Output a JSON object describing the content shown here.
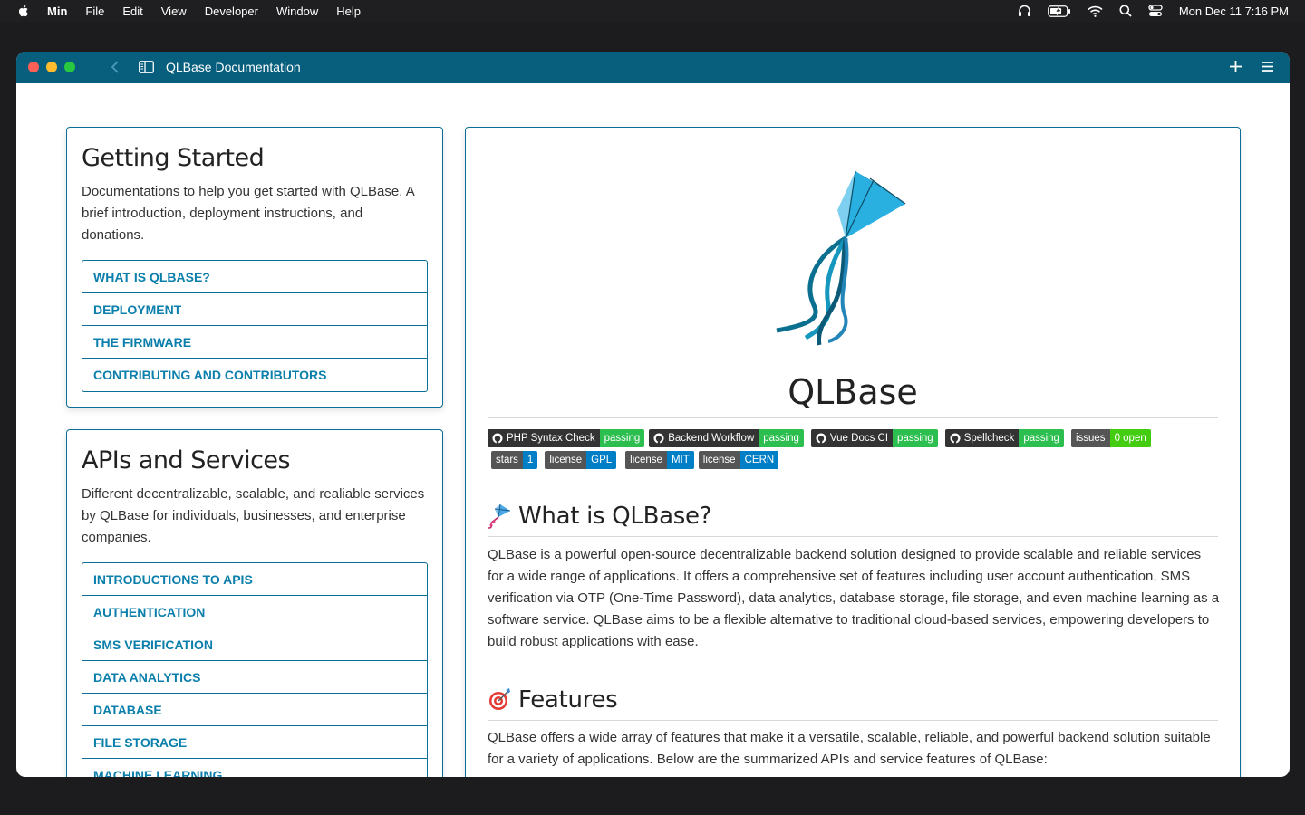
{
  "menubar": {
    "app": "Min",
    "items": [
      "File",
      "Edit",
      "View",
      "Developer",
      "Window",
      "Help"
    ],
    "clock": "Mon Dec 11  7:16 PM"
  },
  "window": {
    "title": "QLBase Documentation"
  },
  "getting_started": {
    "title": "Getting Started",
    "description": "Documentations to help you get started with QLBase. A brief introduction, deployment instructions, and donations.",
    "links": [
      "WHAT IS QLBASE?",
      "DEPLOYMENT",
      "THE FIRMWARE",
      "CONTRIBUTING AND CONTRIBUTORS"
    ]
  },
  "apis": {
    "title": "APIs and Services",
    "description": "Different decentralizable, scalable, and realiable services by QLBase for individuals, businesses, and enterprise companies.",
    "links": [
      "INTRODUCTIONS TO APIS",
      "AUTHENTICATION",
      "SMS VERIFICATION",
      "DATA ANALYTICS",
      "DATABASE",
      "FILE STORAGE",
      "MACHINE LEARNING"
    ]
  },
  "main": {
    "title": "QLBase",
    "badges_row1": [
      {
        "label": "PHP Syntax Check",
        "value": "passing"
      },
      {
        "label": "Backend Workflow",
        "value": "passing"
      },
      {
        "label": "Vue Docs CI",
        "value": "passing"
      },
      {
        "label": "Spellcheck",
        "value": "passing"
      },
      {
        "label": "issues",
        "value": "0 open"
      }
    ],
    "badges_row2": [
      {
        "label": "stars",
        "value": "1"
      },
      {
        "label": "license",
        "value": "GPL"
      },
      {
        "label": "license",
        "value": "MIT"
      },
      {
        "label": "license",
        "value": "CERN"
      }
    ],
    "what_heading": "What is QLBase?",
    "what_text": "QLBase is a powerful open-source decentralizable backend solution designed to provide scalable and reliable services for a wide range of applications. It offers a comprehensive set of features including user account authentication, SMS verification via OTP (One-Time Password), data analytics, database storage, file storage, and even machine learning as a software service. QLBase aims to be a flexible alternative to traditional cloud-based services, empowering developers to build robust applications with ease.",
    "features_heading": "Features",
    "features_text": "QLBase offers a wide array of features that make it a versatile, scalable, reliable, and powerful backend solution suitable for a variety of applications. Below are the summarized APIs and service features of QLBase:"
  },
  "colors": {
    "titlebar": "#075f7d",
    "accent": "#0b7fab",
    "badge_pass": "#2cbe4e",
    "badge_blue": "#007ec6"
  }
}
